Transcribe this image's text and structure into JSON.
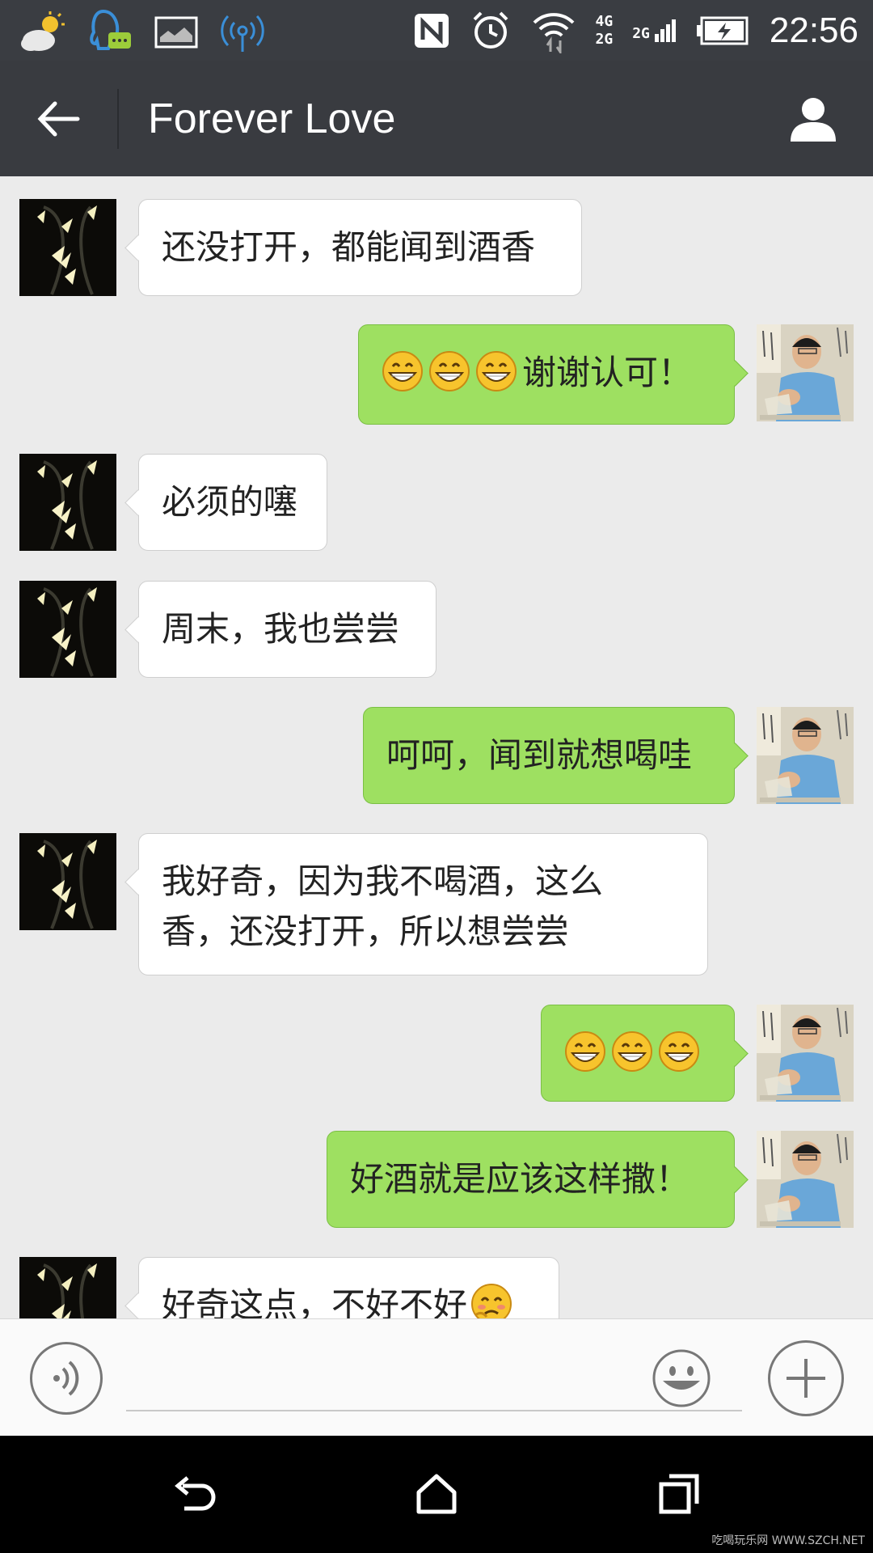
{
  "status_bar": {
    "time": "22:56",
    "network_primary": "4G",
    "network_secondary": "2G",
    "network_tertiary": "2G",
    "icons": [
      "weather-icon",
      "qq-message-icon",
      "gallery-icon",
      "hotspot-icon",
      "nfc-icon",
      "alarm-icon",
      "wifi-icon",
      "signal-4g-icon",
      "signal-2g-icon",
      "battery-charging-icon"
    ]
  },
  "header": {
    "title": "Forever Love",
    "back_icon": "arrow-left-icon",
    "contact_icon": "person-icon"
  },
  "messages": [
    {
      "side": "left",
      "text": "还没打开，都能闻到酒香",
      "emoji_prefix": 0
    },
    {
      "side": "right",
      "text": "谢谢认可！",
      "emoji_prefix": 3
    },
    {
      "side": "left",
      "text": "必须的噻",
      "emoji_prefix": 0
    },
    {
      "side": "left",
      "text": "周末，我也尝尝",
      "emoji_prefix": 0
    },
    {
      "side": "right",
      "text": "呵呵，闻到就想喝哇",
      "emoji_prefix": 0
    },
    {
      "side": "left",
      "text": "我好奇，因为我不喝酒，这么香，还没打开，所以想尝尝",
      "emoji_prefix": 0
    },
    {
      "side": "right",
      "text": "",
      "emoji_prefix": 3
    },
    {
      "side": "right",
      "text": "好酒就是应该这样撒！",
      "emoji_prefix": 0
    },
    {
      "side": "left",
      "text": "好奇这点，不好不好",
      "emoji_suffix": "blush"
    }
  ],
  "input_bar": {
    "voice_icon": "voice-icon",
    "placeholder": "",
    "emoji_icon": "smiley-icon",
    "more_icon": "plus-icon"
  },
  "nav_bar": {
    "icons": [
      "back-nav-icon",
      "home-nav-icon",
      "recents-nav-icon"
    ]
  },
  "watermark": "吃喝玩乐网 WWW.SZCH.NET",
  "colors": {
    "appbar": "#393b40",
    "chat_bg": "#ebebeb",
    "bubble_out": "#9ee061",
    "bubble_in": "#ffffff"
  }
}
